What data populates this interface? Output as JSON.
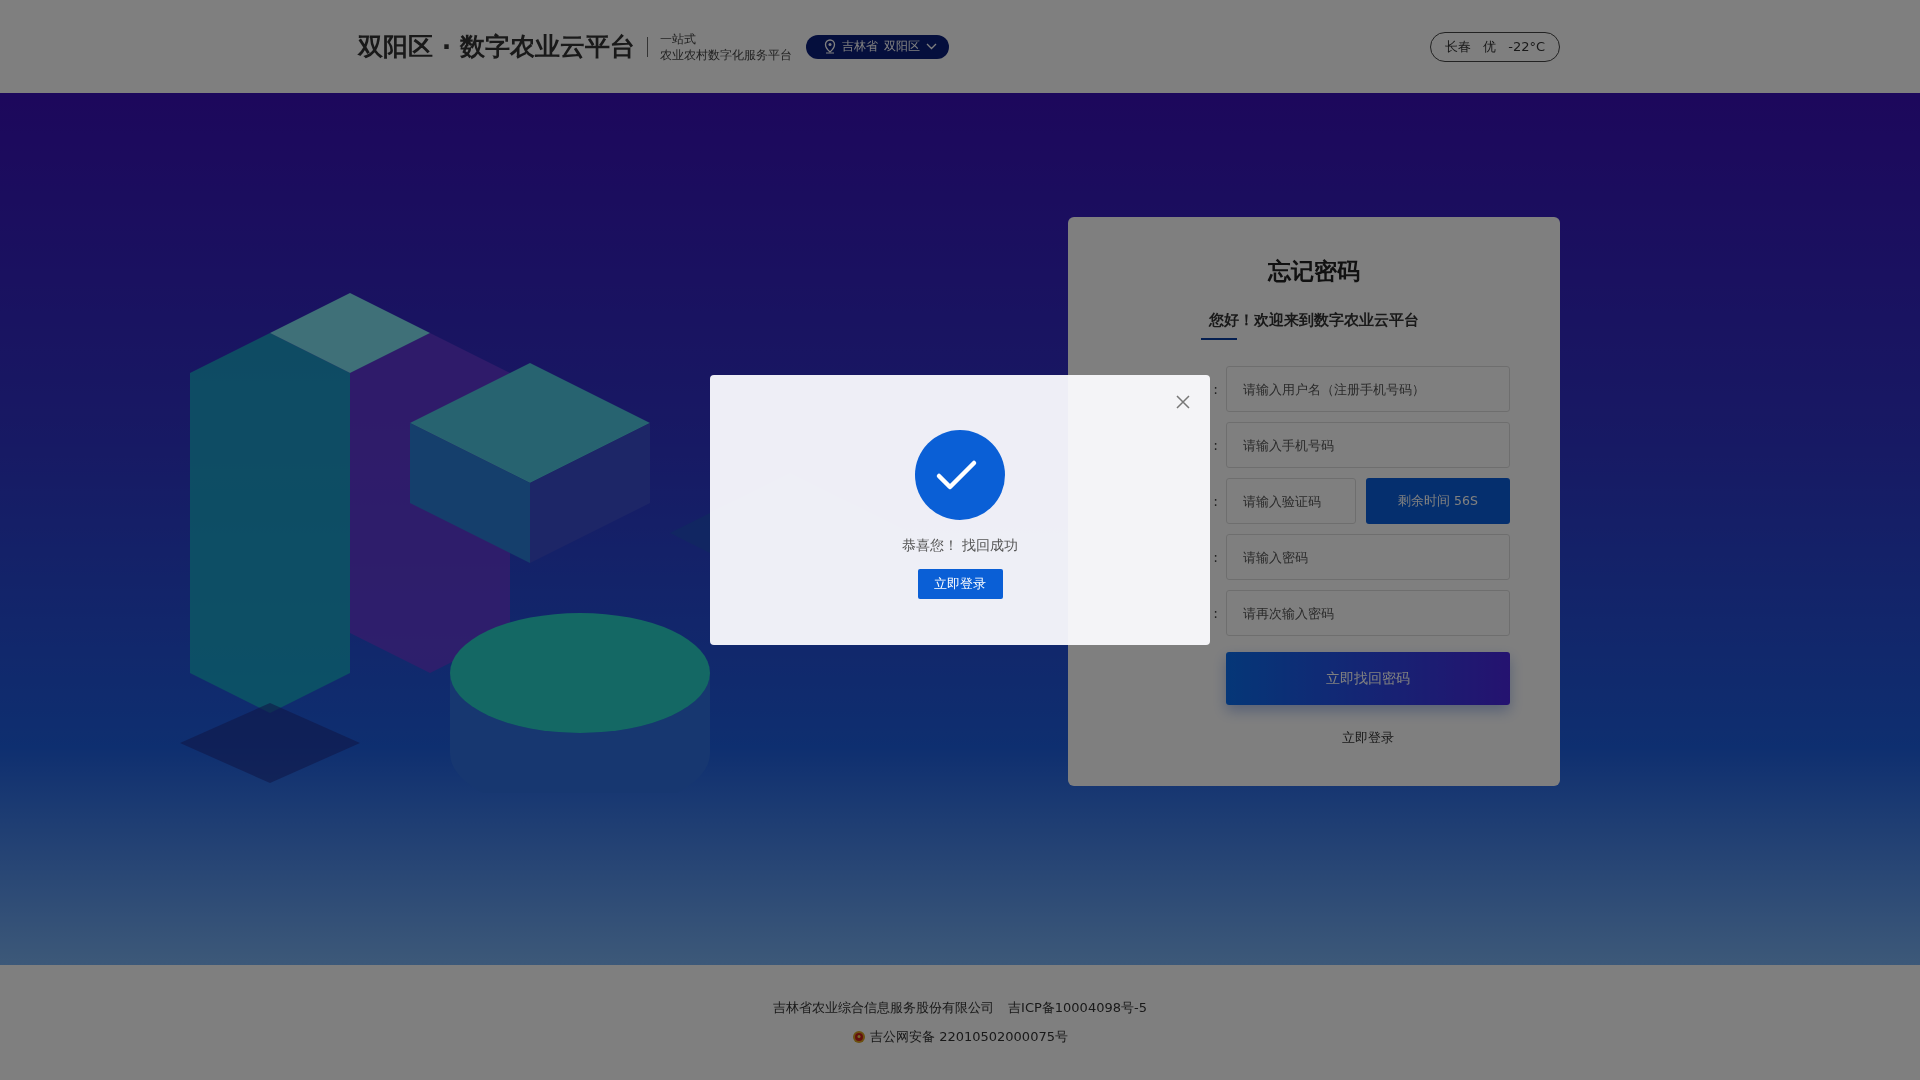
{
  "header": {
    "title": "双阳区 · 数字农业云平台",
    "tagline": [
      "一站式",
      "农业农村数字化服务平台"
    ],
    "location": {
      "province": "吉林省",
      "district": "双阳区"
    },
    "weather": {
      "city": "长春",
      "air_quality": "优",
      "temperature": "-22°C"
    }
  },
  "form": {
    "title": "忘记密码",
    "subtitle": "您好！欢迎来到数字农业云平台",
    "fields": [
      {
        "kind": "text",
        "label": ":",
        "placeholder": "请输入用户名（注册手机号码）"
      },
      {
        "kind": "text",
        "label": ":",
        "placeholder": "请输入手机号码"
      },
      {
        "kind": "code",
        "label": ":",
        "placeholder": "请输入验证码",
        "button": "剩余时间 56S"
      },
      {
        "kind": "password",
        "label": ":",
        "placeholder": "请输入密码"
      },
      {
        "kind": "password",
        "label": ":",
        "placeholder": "请再次输入密码"
      }
    ],
    "submit": "立即找回密码",
    "login_link": "立即登录"
  },
  "footer": {
    "company": "吉林省农业综合信息服务股份有限公司",
    "icp": "吉ICP备10004098号-5",
    "police": "吉公网安备 22010502000075号"
  },
  "dialog": {
    "message": "恭喜您！ 找回成功",
    "button": "立即登录"
  }
}
